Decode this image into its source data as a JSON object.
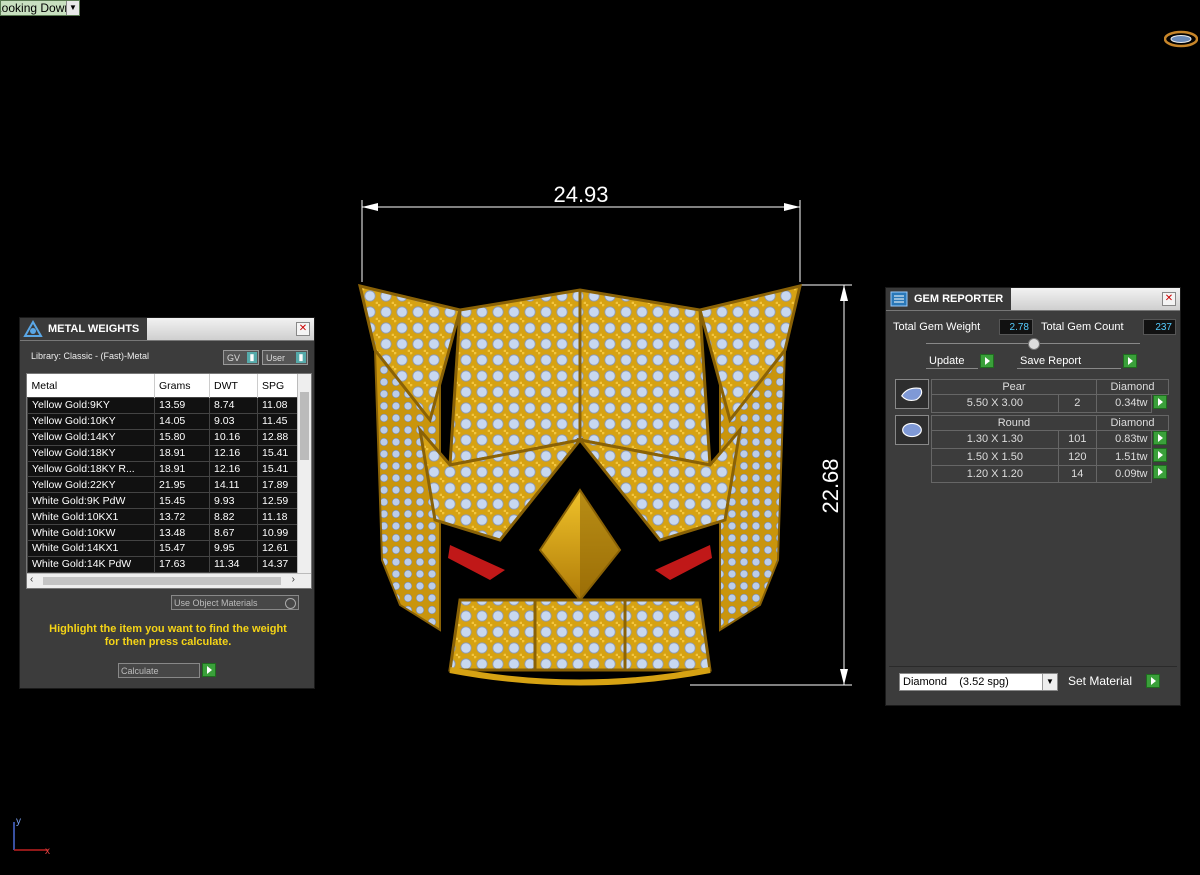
{
  "viewport": {
    "view_select": "Looking Down",
    "dimension_width": "24.93",
    "dimension_height": "22.68",
    "axis_y": "y",
    "axis_x": "x"
  },
  "metal_weights": {
    "title": "METAL WEIGHTS",
    "library_label": "Library: Classic - (Fast)-Metal",
    "toggle_gv": "GV",
    "toggle_user": "User",
    "columns": [
      "Metal",
      "Grams",
      "DWT",
      "SPG"
    ],
    "rows": [
      [
        "Yellow Gold:9KY",
        "13.59",
        "8.74",
        "11.08"
      ],
      [
        "Yellow Gold:10KY",
        "14.05",
        "9.03",
        "11.45"
      ],
      [
        "Yellow Gold:14KY",
        "15.80",
        "10.16",
        "12.88"
      ],
      [
        "Yellow Gold:18KY",
        "18.91",
        "12.16",
        "15.41"
      ],
      [
        "Yellow Gold:18KY R...",
        "18.91",
        "12.16",
        "15.41"
      ],
      [
        "Yellow Gold:22KY",
        "21.95",
        "14.11",
        "17.89"
      ],
      [
        "White Gold:9K PdW",
        "15.45",
        "9.93",
        "12.59"
      ],
      [
        "White Gold:10KX1",
        "13.72",
        "8.82",
        "11.18"
      ],
      [
        "White Gold:10KW",
        "13.48",
        "8.67",
        "10.99"
      ],
      [
        "White Gold:14KX1",
        "15.47",
        "9.95",
        "12.61"
      ],
      [
        "White Gold:14K PdW",
        "17.63",
        "11.34",
        "14.37"
      ]
    ],
    "use_object_materials": "Use Object Materials",
    "hint_line1": "Highlight the item you want to find the weight",
    "hint_line2": "for then press calculate.",
    "calculate_label": "Calculate"
  },
  "gem_reporter": {
    "title": "GEM REPORTER",
    "total_weight_label": "Total Gem Weight",
    "total_weight_value": "2.78",
    "total_count_label": "Total Gem Count",
    "total_count_value": "237",
    "update_label": "Update",
    "save_report_label": "Save Report",
    "groups": [
      {
        "shape": "Pear",
        "material": "Diamond",
        "icon": "pear-gem-icon",
        "rows": [
          [
            "5.50 X 3.00",
            "2",
            "0.34tw"
          ]
        ]
      },
      {
        "shape": "Round",
        "material": "Diamond",
        "icon": "round-gem-icon",
        "rows": [
          [
            "1.30 X 1.30",
            "101",
            "0.83tw"
          ],
          [
            "1.50 X 1.50",
            "120",
            "1.51tw"
          ],
          [
            "1.20 X 1.20",
            "14",
            "0.09tw"
          ]
        ]
      }
    ],
    "material_select": "Diamond    (3.52 spg)",
    "set_material_label": "Set Material"
  },
  "colors": {
    "gold": "#d9a514",
    "gem": "#c8d8f0",
    "accent_green": "#3aa03a",
    "hint_yellow": "#f5d416"
  }
}
